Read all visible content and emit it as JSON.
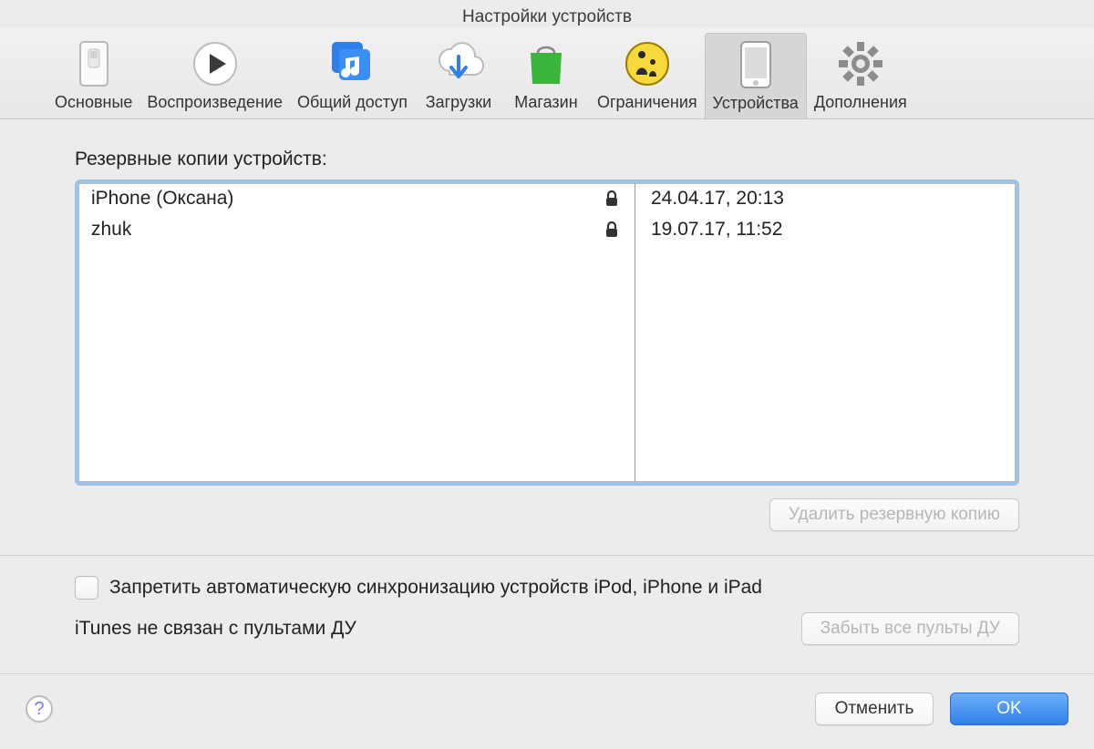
{
  "window": {
    "title": "Настройки устройств"
  },
  "toolbar": {
    "items": [
      {
        "label": "Основные"
      },
      {
        "label": "Воспроизведение"
      },
      {
        "label": "Общий доступ"
      },
      {
        "label": "Загрузки"
      },
      {
        "label": "Магазин"
      },
      {
        "label": "Ограничения"
      },
      {
        "label": "Устройства"
      },
      {
        "label": "Дополнения"
      }
    ]
  },
  "main": {
    "backups_label": "Резервные копии устройств:",
    "backups": [
      {
        "name": "iPhone (Оксана)",
        "date": "24.04.17, 20:13"
      },
      {
        "name": "zhuk",
        "date": "19.07.17, 11:52"
      }
    ],
    "delete_backup_label": "Удалить резервную копию",
    "prevent_sync_label": "Запретить автоматическую синхронизацию устройств iPod, iPhone и iPad",
    "remotes_status": "iTunes не связан с пультами ДУ",
    "forget_remotes_label": "Забыть все пульты ДУ"
  },
  "footer": {
    "cancel": "Отменить",
    "ok": "OK"
  }
}
